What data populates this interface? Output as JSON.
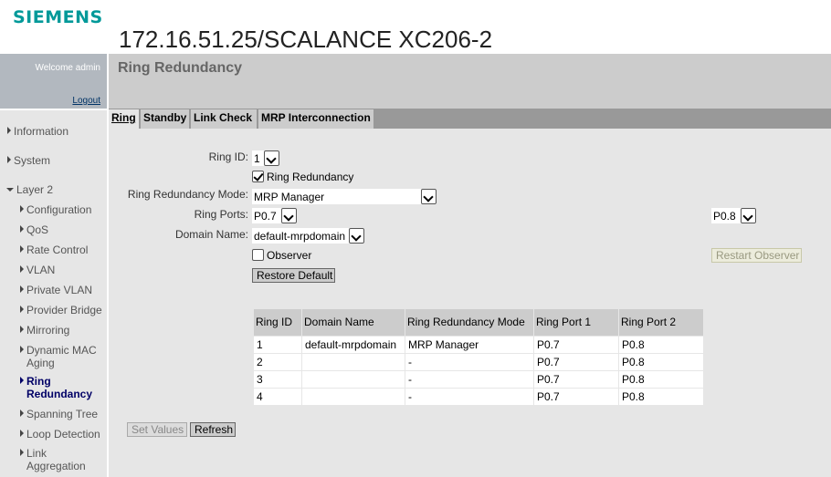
{
  "header": {
    "logo": "SIEMENS",
    "device_title": "172.16.51.25/SCALANCE XC206-2"
  },
  "sidebar": {
    "welcome": "Welcome admin",
    "logout": "Logout",
    "items": [
      {
        "label": "Information"
      },
      {
        "label": "System"
      },
      {
        "label": "Layer 2"
      },
      {
        "label": "Configuration"
      },
      {
        "label": "QoS"
      },
      {
        "label": "Rate Control"
      },
      {
        "label": "VLAN"
      },
      {
        "label": "Private VLAN"
      },
      {
        "label": "Provider Bridge"
      },
      {
        "label": "Mirroring"
      },
      {
        "label": "Dynamic MAC",
        "label2": "Aging"
      },
      {
        "label": "Ring",
        "label2": "Redundancy"
      },
      {
        "label": "Spanning Tree"
      },
      {
        "label": "Loop Detection"
      },
      {
        "label": "Link",
        "label2": "Aggregation"
      }
    ]
  },
  "page": {
    "title": "Ring Redundancy",
    "tabs": [
      {
        "label": "Ring"
      },
      {
        "label": "Standby"
      },
      {
        "label": "Link Check"
      },
      {
        "label": "MRP Interconnection"
      }
    ]
  },
  "form": {
    "ring_id_label": "Ring ID:",
    "ring_id_value": "1",
    "ring_redundancy_label": "Ring Redundancy",
    "ring_redundancy_checked": true,
    "mode_label": "Ring Redundancy Mode:",
    "mode_value": "MRP Manager",
    "ports_label": "Ring Ports:",
    "port1_value": "P0.7",
    "port2_value": "P0.8",
    "domain_label": "Domain Name:",
    "domain_value": "default-mrpdomain",
    "observer_label": "Observer",
    "observer_checked": false,
    "restart_observer": "Restart Observer",
    "restore_default": "Restore Default"
  },
  "table": {
    "headers": [
      "Ring ID",
      "Domain Name",
      "Ring Redundancy Mode",
      "Ring Port 1",
      "Ring Port 2"
    ],
    "rows": [
      [
        "1",
        "default-mrpdomain",
        "MRP Manager",
        "P0.7",
        "P0.8"
      ],
      [
        "2",
        "",
        "-",
        "P0.7",
        "P0.8"
      ],
      [
        "3",
        "",
        "-",
        "P0.7",
        "P0.8"
      ],
      [
        "4",
        "",
        "-",
        "P0.7",
        "P0.8"
      ]
    ]
  },
  "footer": {
    "set_values": "Set Values",
    "refresh": "Refresh"
  },
  "colors": {
    "brand": "#009999",
    "sidebar_top": "#b2b8bf",
    "active_nav": "#000066"
  }
}
